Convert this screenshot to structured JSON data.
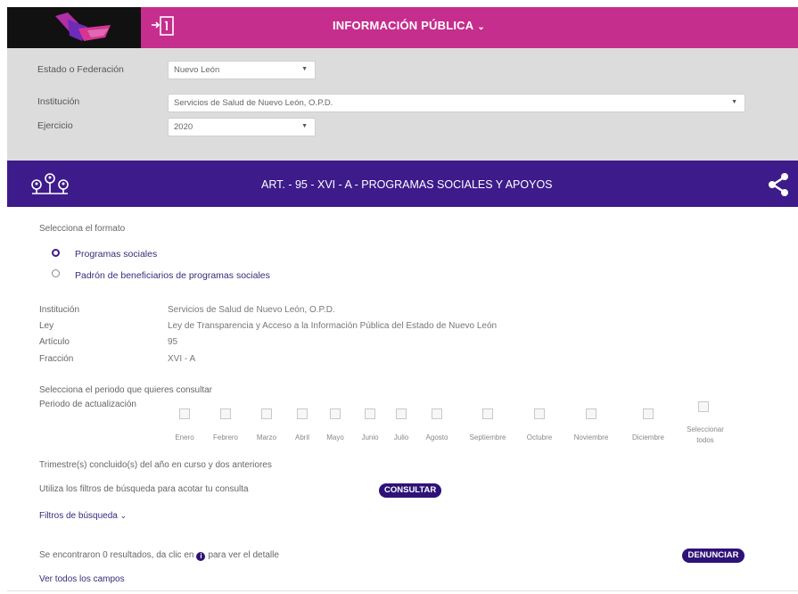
{
  "header": {
    "title": "INFORMACIÓN PÚBLICA",
    "logo_icon": "tricolor-ribbon-logo",
    "login_icon": "login-arrow-icon",
    "brand_pink": "#c52e8d",
    "brand_dark": "#111111"
  },
  "filters": {
    "estado_label": "Estado o Federación",
    "estado_value": "Nuevo León",
    "institucion_label": "Institución",
    "institucion_value": "Servicios de Salud de Nuevo León, O.P.D.",
    "ejercicio_label": "Ejercicio",
    "ejercicio_value": "2020"
  },
  "article": {
    "title": "ART. - 95 - XVI - A - PROGRAMAS SOCIALES Y APOYOS",
    "icon": "people-network-icon",
    "share_icon": "share-icon",
    "color": "#3e1b8b"
  },
  "format": {
    "prompt": "Selecciona el formato",
    "options": [
      {
        "label": "Programas sociales",
        "selected": true
      },
      {
        "label": "Padrón de beneficiarios de programas sociales",
        "selected": false
      }
    ]
  },
  "meta": {
    "institucion_key": "Institución",
    "institucion_val": "Servicios de Salud de Nuevo León, O.P.D.",
    "ley_key": "Ley",
    "ley_val": "Ley de Transparencia y Acceso a la Información Pública del Estado de Nuevo León",
    "articulo_key": "Artículo",
    "articulo_val": "95",
    "fraccion_key": "Fracción",
    "fraccion_val": "XVI - A"
  },
  "period": {
    "prompt": "Selecciona el periodo que quieres consultar",
    "label": "Periodo de actualización",
    "months": [
      "Enero",
      "Febrero",
      "Marzo",
      "Abril",
      "Mayo",
      "Junio",
      "Julio",
      "Agosto",
      "Septiembre",
      "Octubre",
      "Noviembre",
      "Diciembre"
    ],
    "select_all": "Seleccionar todos",
    "note": "Trimestre(s) concluido(s) del año en curso y dos anteriores"
  },
  "search": {
    "hint": "Utiliza los filtros de búsqueda para acotar tu consulta",
    "consultar": "CONSULTAR",
    "filters_link": "Filtros de búsqueda"
  },
  "results": {
    "text_before": "Se encontraron 0 resultados, da clic en",
    "text_after": "para ver el detalle",
    "denunciar": "DENUNCIAR",
    "ver_todos": "Ver todos los campos"
  }
}
